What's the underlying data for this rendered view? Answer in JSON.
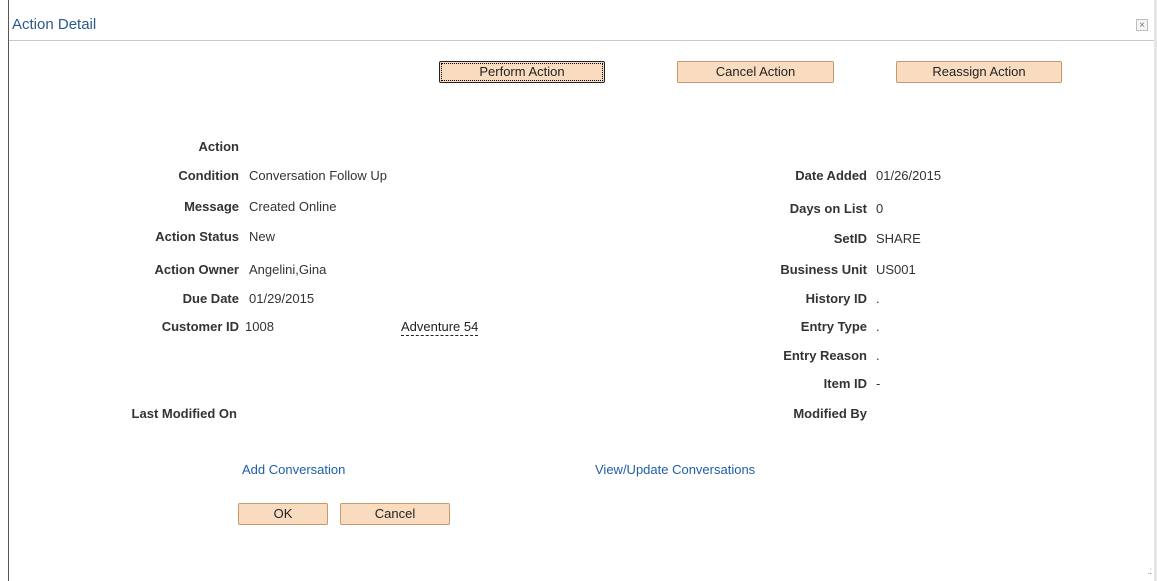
{
  "dialog": {
    "title": "Action Detail",
    "close_icon": "close-icon",
    "close_glyph": "×"
  },
  "toolbar": {
    "perform_label": "Perform Action",
    "cancel_action_label": "Cancel Action",
    "reassign_label": "Reassign Action"
  },
  "left_fields": {
    "action_label": "Action",
    "action_value": "",
    "condition_label": "Condition",
    "condition_value": "Conversation Follow Up",
    "message_label": "Message",
    "message_value": "Created Online",
    "status_label": "Action Status",
    "status_value": "New",
    "owner_label": "Action Owner",
    "owner_value": "Angelini,Gina",
    "due_label": "Due Date",
    "due_value": "01/29/2015",
    "customer_label": "Customer ID",
    "customer_value": "1008",
    "customer_name": "Adventure 54",
    "last_modified_label": "Last Modified On",
    "last_modified_value": ""
  },
  "right_fields": {
    "date_added_label": "Date Added",
    "date_added_value": "01/26/2015",
    "days_label": "Days on List",
    "days_value": "0",
    "setid_label": "SetID",
    "setid_value": "SHARE",
    "bu_label": "Business Unit",
    "bu_value": "US001",
    "history_label": "History ID",
    "history_value": ".",
    "entry_type_label": "Entry Type",
    "entry_type_value": ".",
    "entry_reason_label": "Entry Reason",
    "entry_reason_value": ".",
    "item_label": "Item ID",
    "item_value": "-",
    "modified_by_label": "Modified By",
    "modified_by_value": ""
  },
  "links": {
    "add_conversation": "Add Conversation",
    "view_update": "View/Update Conversations"
  },
  "footer": {
    "ok_label": "OK",
    "cancel_label": "Cancel"
  },
  "colors": {
    "button_bg": "#f9dcc0",
    "link": "#1f5ea8",
    "title": "#2a5a8a"
  }
}
